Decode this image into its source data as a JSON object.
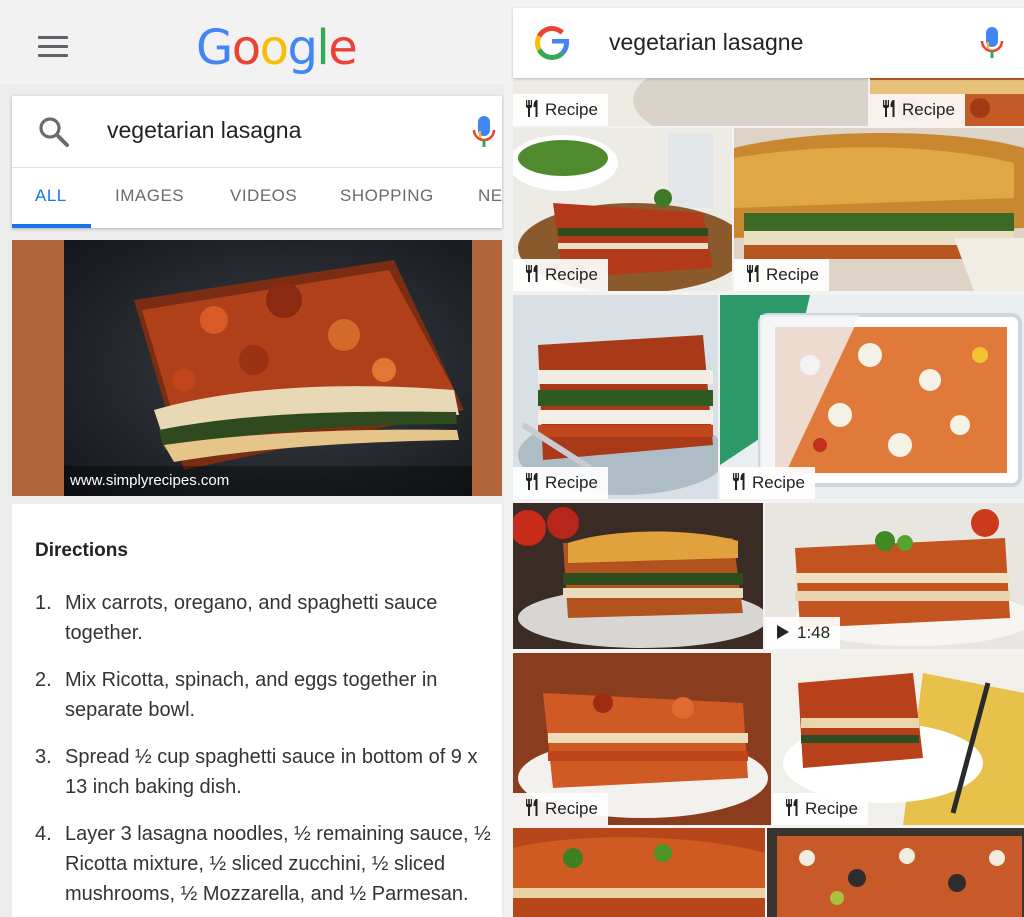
{
  "left": {
    "logo_letters": [
      {
        "char": "G",
        "color": "#4285F4"
      },
      {
        "char": "o",
        "color": "#EA4335"
      },
      {
        "char": "o",
        "color": "#FBBC05"
      },
      {
        "char": "g",
        "color": "#4285F4"
      },
      {
        "char": "l",
        "color": "#34A853"
      },
      {
        "char": "e",
        "color": "#EA4335"
      }
    ],
    "search": {
      "query": "vegetarian lasagna"
    },
    "tabs": [
      {
        "label": "ALL",
        "active": true
      },
      {
        "label": "IMAGES",
        "active": false
      },
      {
        "label": "VIDEOS",
        "active": false
      },
      {
        "label": "SHOPPING",
        "active": false
      },
      {
        "label": "NEWS",
        "active": false
      }
    ],
    "hero": {
      "source": "www.simplyrecipes.com"
    },
    "directions": {
      "title": "Directions",
      "steps": [
        {
          "num": "1.",
          "text": "Mix carrots, oregano, and spaghetti sauce together."
        },
        {
          "num": "2.",
          "text": "Mix Ricotta, spinach, and eggs together in separate bowl."
        },
        {
          "num": "3.",
          "text": "Spread ½ cup spaghetti sauce in bottom of 9 x 13 inch baking dish."
        },
        {
          "num": "4.",
          "text": "Layer 3 lasagna noodles, ½ remaining sauce, ½ Ricotta mixture, ½ sliced zucchini, ½ sliced mushrooms, ½ Mozzarella, and ½ Parmesan."
        }
      ]
    }
  },
  "right": {
    "search": {
      "query": "vegetarian lasagne"
    },
    "tiles": [
      {
        "badge": "Recipe",
        "icon": "fork-knife-icon"
      },
      {
        "badge": "Recipe",
        "icon": "fork-knife-icon"
      },
      {
        "badge": "Recipe",
        "icon": "fork-knife-icon"
      },
      {
        "badge": "Recipe",
        "icon": "fork-knife-icon"
      },
      {
        "badge": "Recipe",
        "icon": "fork-knife-icon"
      },
      {
        "badge": "Recipe",
        "icon": "fork-knife-icon"
      },
      {
        "badge": "",
        "icon": ""
      },
      {
        "badge": "1:48",
        "icon": "play-icon"
      },
      {
        "badge": "Recipe",
        "icon": "fork-knife-icon"
      },
      {
        "badge": "Recipe",
        "icon": "fork-knife-icon"
      },
      {
        "badge": "",
        "icon": ""
      },
      {
        "badge": "",
        "icon": ""
      }
    ]
  },
  "colors": {
    "accent": "#1a73e8",
    "hero_background": "#b0663a"
  }
}
